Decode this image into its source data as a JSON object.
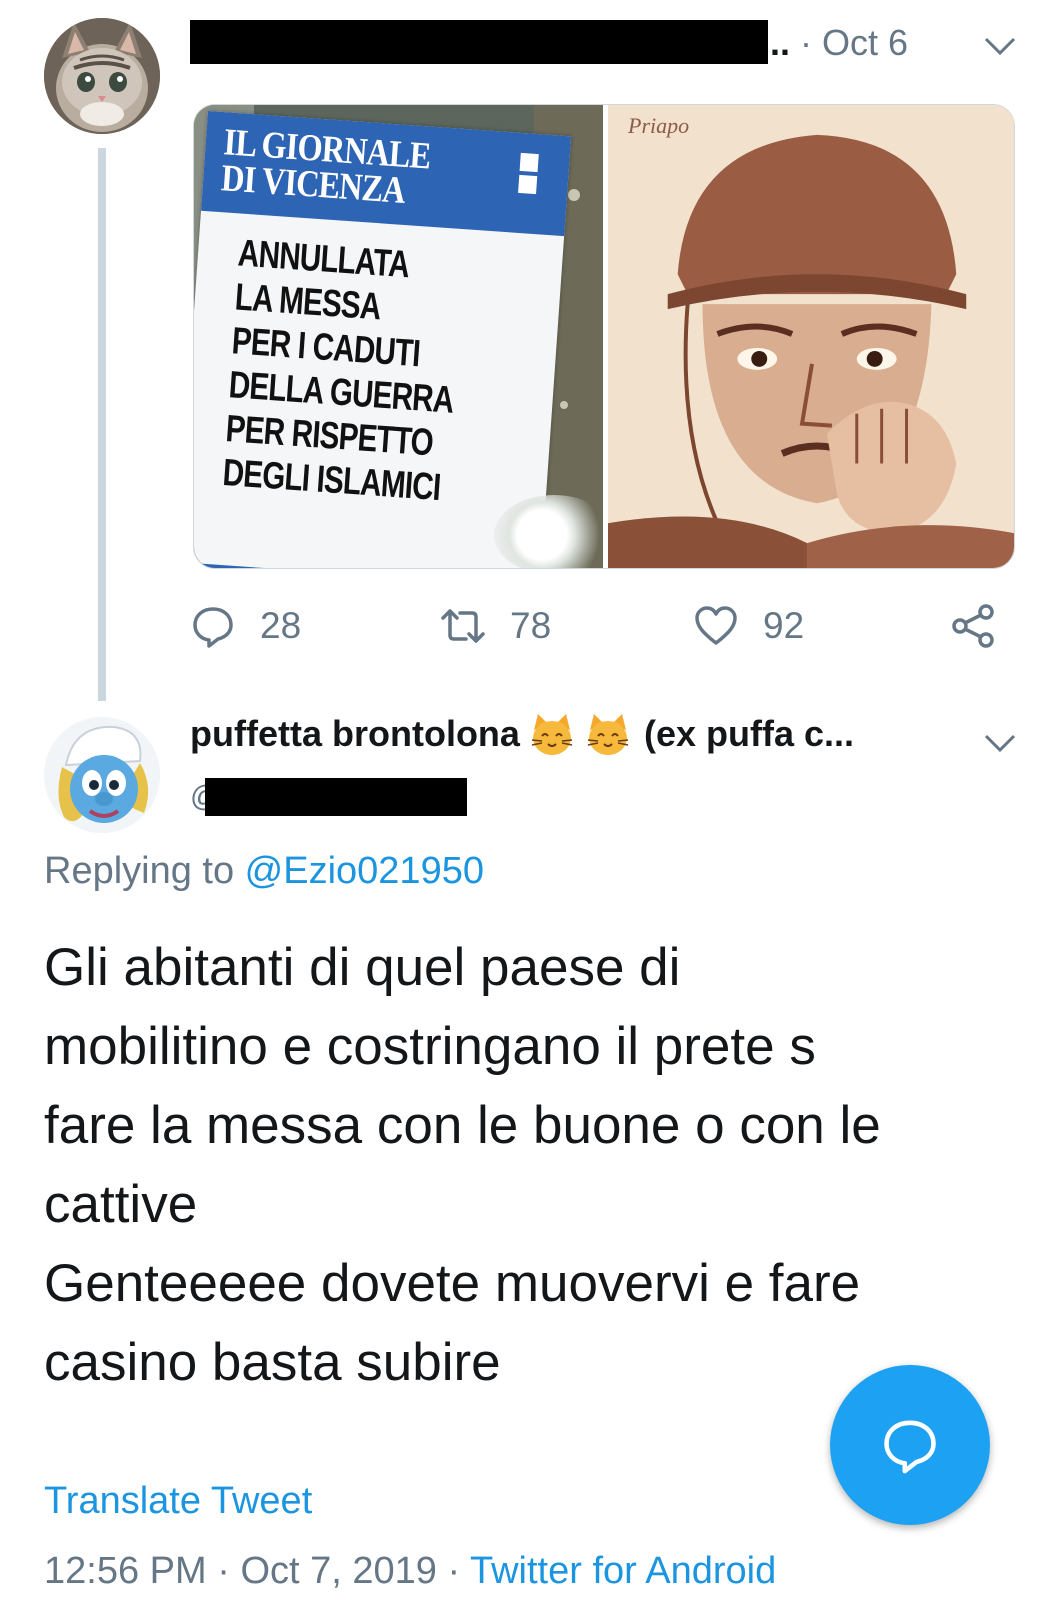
{
  "parent_tweet": {
    "separator": "·",
    "truncation": "..",
    "date": "Oct 6",
    "media": {
      "left_image": {
        "masthead": "IL GIORNALE\nDI VICENZA",
        "headline": "ANNULLATA\nLA MESSA\nPER I CADUTI\nDELLA GUERRA\nPER RISPETTO\nDEGLI ISLAMICI"
      },
      "right_image": {
        "signature": "Priapo"
      }
    },
    "actions": {
      "reply_count": "28",
      "retweet_count": "78",
      "like_count": "92"
    }
  },
  "reply_tweet": {
    "display_name": "puffetta brontolona",
    "display_name_suffix": "(ex puffa c...",
    "handle_fragment": "@",
    "replying_prefix": "Replying to ",
    "replying_handle": "@Ezio021950",
    "text_lines": [
      "Gli abitanti di quel paese di",
      "mobilitino e costringano il prete s",
      "fare la messa con le buone o con le",
      "cattive",
      "Genteeeee dovete muovervi e fare",
      "casino basta subire"
    ],
    "translate_label": "Translate Tweet",
    "time": "12:56 PM",
    "date": "Oct 7, 2019",
    "client": "Twitter for Android"
  },
  "colors": {
    "accent": "#1b95e0",
    "fab": "#1da1f2",
    "muted": "#657786",
    "thread_line": "#ccd6dd"
  }
}
